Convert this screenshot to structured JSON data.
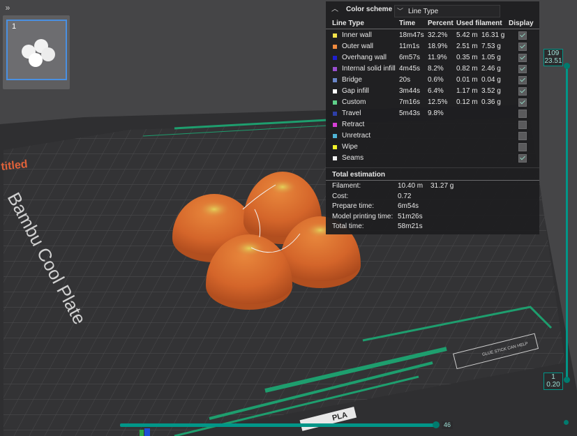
{
  "toolbar": {
    "collapse_glyph": "»"
  },
  "plate_list": {
    "plate_number": "1"
  },
  "bed": {
    "name_text": "Bambu Cool Plate",
    "title_fragment": "titled",
    "material_label": "PLA",
    "glue_hint": "GLUE STICK CAN HELP"
  },
  "color_scheme": {
    "title": "Color scheme",
    "selected": "Line Type",
    "headers": {
      "line_type": "Line Type",
      "time": "Time",
      "percent": "Percent",
      "used": "Used filament",
      "display": "Display"
    },
    "rows": [
      {
        "name": "Inner wall",
        "color": "#f2e24a",
        "time": "18m47s",
        "percent": "32.2%",
        "length": "5.42 m",
        "weight": "16.31 g",
        "display": true
      },
      {
        "name": "Outer wall",
        "color": "#f08a3e",
        "time": "11m1s",
        "percent": "18.9%",
        "length": "2.51 m",
        "weight": "7.53 g",
        "display": true
      },
      {
        "name": "Overhang wall",
        "color": "#1f1fcf",
        "time": "6m57s",
        "percent": "11.9%",
        "length": "0.35 m",
        "weight": "1.05 g",
        "display": true
      },
      {
        "name": "Internal solid infill",
        "color": "#9a4fd0",
        "time": "4m45s",
        "percent": "8.2%",
        "length": "0.82 m",
        "weight": "2.46 g",
        "display": true
      },
      {
        "name": "Bridge",
        "color": "#6a86c8",
        "time": "20s",
        "percent": "0.6%",
        "length": "0.01 m",
        "weight": "0.04 g",
        "display": true
      },
      {
        "name": "Gap infill",
        "color": "#ffffff",
        "time": "3m44s",
        "percent": "6.4%",
        "length": "1.17 m",
        "weight": "3.52 g",
        "display": true
      },
      {
        "name": "Custom",
        "color": "#5fd08a",
        "time": "7m16s",
        "percent": "12.5%",
        "length": "0.12 m",
        "weight": "0.36 g",
        "display": true
      },
      {
        "name": "Travel",
        "color": "#2e3fa8",
        "time": "5m43s",
        "percent": "9.8%",
        "length": "",
        "weight": "",
        "display": false
      },
      {
        "name": "Retract",
        "color": "#d63fd6",
        "time": "",
        "percent": "",
        "length": "",
        "weight": "",
        "display": false
      },
      {
        "name": "Unretract",
        "color": "#4fb4d6",
        "time": "",
        "percent": "",
        "length": "",
        "weight": "",
        "display": false
      },
      {
        "name": "Wipe",
        "color": "#f2f22a",
        "time": "",
        "percent": "",
        "length": "",
        "weight": "",
        "display": false
      },
      {
        "name": "Seams",
        "color": "#f0f0f0",
        "time": "",
        "percent": "",
        "length": "",
        "weight": "",
        "display": true
      }
    ],
    "estimation_title": "Total estimation",
    "estimation": [
      {
        "label": "Filament:",
        "value": "10.40 m",
        "value2": "31.27 g"
      },
      {
        "label": "Cost:",
        "value": "0.72",
        "value2": ""
      },
      {
        "label": "Prepare time:",
        "value": "6m54s",
        "value2": ""
      },
      {
        "label": "Model printing time:",
        "value": "51m26s",
        "value2": ""
      },
      {
        "label": "Total time:",
        "value": "58m21s",
        "value2": ""
      }
    ]
  },
  "layer_slider": {
    "top_layer": "109",
    "top_height": "23.51",
    "bottom_layer": "1",
    "bottom_height": "0.20"
  },
  "move_slider": {
    "value": "46"
  },
  "colors": {
    "accent": "#009688",
    "object": "#d9692a"
  }
}
